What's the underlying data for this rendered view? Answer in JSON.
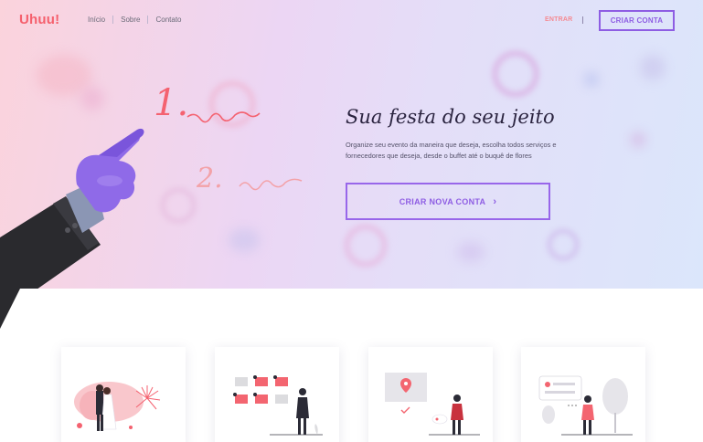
{
  "brand": {
    "logo": "Uhuu!"
  },
  "nav": {
    "items": [
      {
        "label": "Início"
      },
      {
        "label": "Sobre"
      },
      {
        "label": "Contato"
      }
    ],
    "login_label": "ENTRAR",
    "separator": "|",
    "signup_label": "CRIAR CONTA"
  },
  "hero": {
    "title": "Sua festa do seu jeito",
    "subtitle": "Organize seu evento da maneira que deseja, escolha todos serviços e fornecedores que deseja, desde o buffet até o buquê de flores",
    "cta_label": "CRIAR NOVA CONTA",
    "cta_icon": "chevron-right-icon",
    "annotations": [
      "1.",
      "2."
    ]
  },
  "cards": [
    {
      "illustration": "wedding-couple-illustration"
    },
    {
      "illustration": "calendar-planning-illustration"
    },
    {
      "illustration": "location-map-illustration"
    },
    {
      "illustration": "chat-message-illustration"
    }
  ],
  "colors": {
    "brand": "#f5606d",
    "accent": "#8e5de3",
    "hero_gradient_start": "#fbd3dc",
    "hero_gradient_end": "#dbe6fb"
  }
}
